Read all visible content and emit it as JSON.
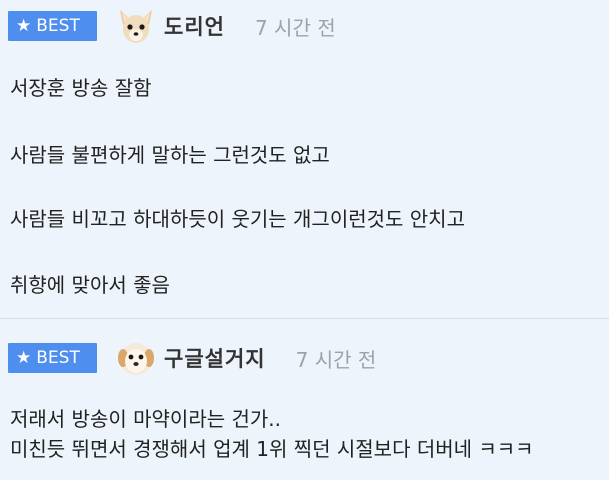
{
  "comments": [
    {
      "badge": "BEST",
      "nickname": "도리언",
      "time": "7 시간 전",
      "lines": [
        "서장훈 방송 잘함",
        "사람들 불편하게 말하는 그런것도 없고",
        "사람들 비꼬고 하대하듯이 웃기는 개그이런것도 안치고",
        "취향에 맞아서 좋음"
      ]
    },
    {
      "badge": "BEST",
      "nickname": "구글설거지",
      "time": "7 시간 전",
      "lines": [
        "저래서 방송이 마약이라는 건가..",
        "미친듯 뛰면서 경쟁해서 업계 1위 찍던 시절보다 더버네 ㅋㅋㅋ"
      ]
    }
  ],
  "colors": {
    "background": "#eef4fb",
    "badge": "#4d8eee",
    "time": "#9aa3ad",
    "divider": "#d6dde6"
  },
  "icons": {
    "badge": "star-icon",
    "avatar_1": "chihuahua-avatar",
    "avatar_2": "puppy-avatar"
  }
}
